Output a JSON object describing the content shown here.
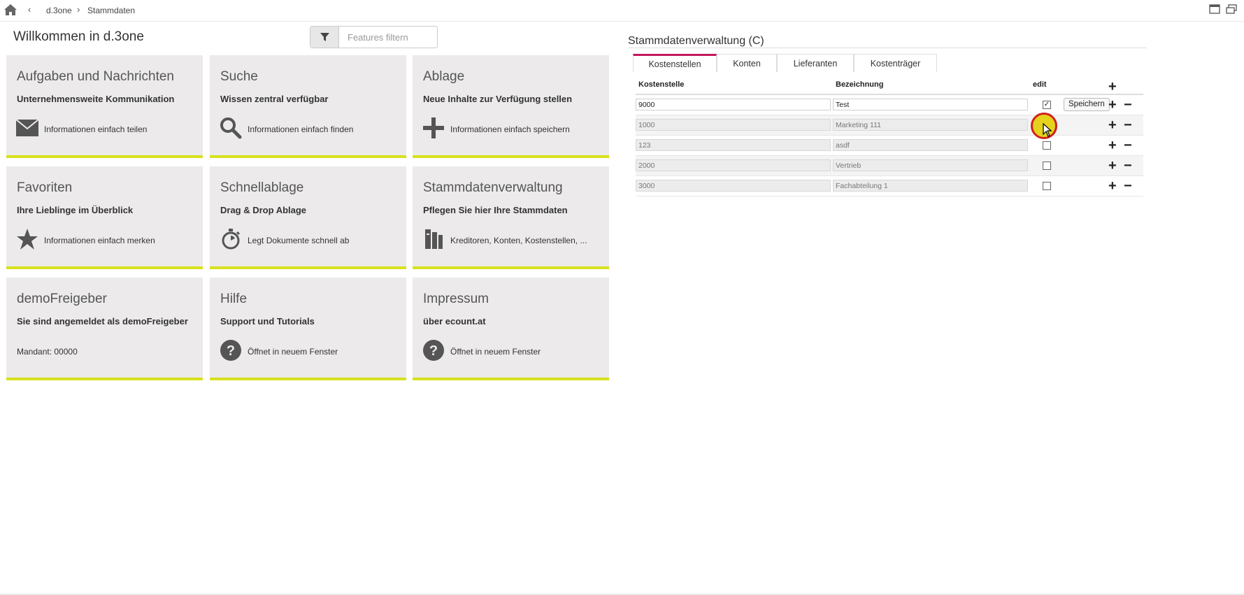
{
  "breadcrumb": {
    "items": [
      "d.3one",
      "Stammdaten"
    ],
    "back": "‹",
    "sep": "›"
  },
  "welcome": "Willkommen in d.3one",
  "filter": {
    "placeholder": "Features filtern"
  },
  "tiles": [
    {
      "title": "Aufgaben und Nachrichten",
      "subtitle": "Unternehmensweite Kommunikation",
      "text": "Informationen einfach teilen",
      "icon": "envelope-icon"
    },
    {
      "title": "Suche",
      "subtitle": "Wissen zentral verfügbar",
      "text": "Informationen einfach finden",
      "icon": "search-icon"
    },
    {
      "title": "Ablage",
      "subtitle": "Neue Inhalte zur Verfügung stellen",
      "text": "Informationen einfach speichern",
      "icon": "plus-icon"
    },
    {
      "title": "Favoriten",
      "subtitle": "Ihre Lieblinge im Überblick",
      "text": "Informationen einfach merken",
      "icon": "star-icon"
    },
    {
      "title": "Schnellablage",
      "subtitle": "Drag & Drop Ablage",
      "text": "Legt Dokumente schnell ab",
      "icon": "stopwatch-icon"
    },
    {
      "title": "Stammdatenverwaltung",
      "subtitle": "Pflegen Sie hier Ihre Stammdaten",
      "text": "Kreditoren, Konten, Kostenstellen, ...",
      "icon": "books-icon"
    },
    {
      "title": "demoFreigeber",
      "subtitle": "Sie sind angemeldet als demoFreigeber",
      "text": "Mandant: 00000",
      "icon": ""
    },
    {
      "title": "Hilfe",
      "subtitle": "Support und Tutorials",
      "text": "Öffnet in neuem Fenster",
      "icon": "question-icon"
    },
    {
      "title": "Impressum",
      "subtitle": "über ecount.at",
      "text": "Öffnet in neuem Fenster",
      "icon": "question-icon"
    }
  ],
  "panel": {
    "title": "Stammdatenverwaltung (C)",
    "tabs": [
      "Kostenstellen",
      "Konten",
      "Lieferanten",
      "Kostenträger"
    ],
    "active_tab": "Kostenstellen",
    "columns": [
      "Kostenstelle",
      "Bezeichnung",
      "edit"
    ],
    "rows": [
      {
        "kostenstelle": "9000",
        "bezeichnung": "Test",
        "edit": true,
        "editable": true
      },
      {
        "kostenstelle": "1000",
        "bezeichnung": "Marketing 111",
        "edit": false,
        "editable": false
      },
      {
        "kostenstelle": "123",
        "bezeichnung": "asdf",
        "edit": false,
        "editable": false
      },
      {
        "kostenstelle": "2000",
        "bezeichnung": "Vertrieb",
        "edit": false,
        "editable": false
      },
      {
        "kostenstelle": "3000",
        "bezeichnung": "Fachabteilung 1",
        "edit": false,
        "editable": false
      }
    ],
    "save_label": "Speichern",
    "plus": "+",
    "minus": "−",
    "check_mark": "✓"
  },
  "colors": {
    "accent_bar": "#d7e11f",
    "active_tab": "#c2185b",
    "tile_bg": "#eceaea",
    "highlight_fill": "#e5d21c",
    "highlight_ring": "#d21f1f"
  }
}
